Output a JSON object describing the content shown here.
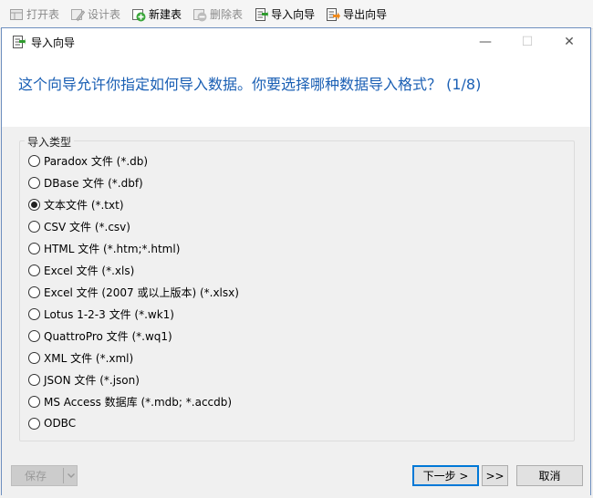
{
  "toolbar": {
    "items": [
      {
        "label": "打开表",
        "icon": "open-table-icon",
        "enabled": false
      },
      {
        "label": "设计表",
        "icon": "design-table-icon",
        "enabled": false
      },
      {
        "label": "新建表",
        "icon": "new-table-icon",
        "enabled": true
      },
      {
        "label": "删除表",
        "icon": "delete-table-icon",
        "enabled": false
      },
      {
        "label": "导入向导",
        "icon": "import-wizard-icon",
        "enabled": true
      },
      {
        "label": "导出向导",
        "icon": "export-wizard-icon",
        "enabled": true
      }
    ]
  },
  "dialog": {
    "title": "导入向导",
    "heading": "这个向导允许你指定如何导入数据。你要选择哪种数据导入格式？ (1/8)",
    "controls": {
      "minimize": "—",
      "maximize": "☐",
      "close": "✕"
    },
    "group_label": "导入类型",
    "options": [
      {
        "label": "Paradox 文件 (*.db)",
        "checked": false
      },
      {
        "label": "DBase 文件 (*.dbf)",
        "checked": false
      },
      {
        "label": "文本文件 (*.txt)",
        "checked": true
      },
      {
        "label": "CSV 文件 (*.csv)",
        "checked": false
      },
      {
        "label": "HTML 文件 (*.htm;*.html)",
        "checked": false
      },
      {
        "label": "Excel 文件 (*.xls)",
        "checked": false
      },
      {
        "label": "Excel 文件 (2007 或以上版本) (*.xlsx)",
        "checked": false
      },
      {
        "label": "Lotus 1-2-3 文件 (*.wk1)",
        "checked": false
      },
      {
        "label": "QuattroPro 文件 (*.wq1)",
        "checked": false
      },
      {
        "label": "XML 文件 (*.xml)",
        "checked": false
      },
      {
        "label": "JSON 文件 (*.json)",
        "checked": false
      },
      {
        "label": "MS Access 数据库 (*.mdb; *.accdb)",
        "checked": false
      },
      {
        "label": "ODBC",
        "checked": false
      }
    ],
    "buttons": {
      "save": "保存",
      "next": "下一步 >",
      "skip": ">>",
      "cancel": "取消"
    }
  },
  "colors": {
    "heading": "#1a5fb4",
    "primary_border": "#0078d7"
  }
}
